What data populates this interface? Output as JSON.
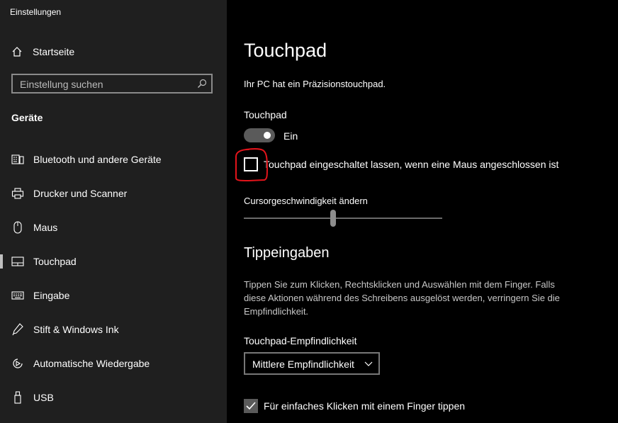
{
  "app": {
    "title": "Einstellungen"
  },
  "sidebar": {
    "home_label": "Startseite",
    "search_placeholder": "Einstellung suchen",
    "section_title": "Geräte",
    "items": [
      {
        "label": "Bluetooth und andere Geräte",
        "icon": "bluetooth-devices-icon",
        "selected": false
      },
      {
        "label": "Drucker und Scanner",
        "icon": "printer-icon",
        "selected": false
      },
      {
        "label": "Maus",
        "icon": "mouse-icon",
        "selected": false
      },
      {
        "label": "Touchpad",
        "icon": "touchpad-icon",
        "selected": true
      },
      {
        "label": "Eingabe",
        "icon": "keyboard-icon",
        "selected": false
      },
      {
        "label": "Stift & Windows Ink",
        "icon": "pen-icon",
        "selected": false
      },
      {
        "label": "Automatische Wiedergabe",
        "icon": "autoplay-icon",
        "selected": false
      },
      {
        "label": "USB",
        "icon": "usb-icon",
        "selected": false
      }
    ]
  },
  "main": {
    "title": "Touchpad",
    "precision_note": "Ihr PC hat ein Präzisionstouchpad.",
    "touchpad_label": "Touchpad",
    "toggle": {
      "state_label": "Ein",
      "on": true
    },
    "mouse_checkbox": {
      "label": "Touchpad eingeschaltet lassen, wenn eine Maus angeschlossen ist",
      "checked": false
    },
    "cursor_speed": {
      "label": "Cursorgeschwindigkeit ändern",
      "value_fraction": 0.45
    },
    "tapping": {
      "heading": "Tippeingaben",
      "description": "Tippen Sie zum Klicken, Rechtsklicken und Auswählen mit dem Finger. Falls diese Aktionen während des Schreibens ausgelöst werden, verringern Sie die Empfindlichkeit.",
      "sensitivity_label": "Touchpad-Empfindlichkeit",
      "sensitivity_value": "Mittlere Empfindlichkeit",
      "single_tap": {
        "label": "Für einfaches Klicken mit einem Finger tippen",
        "checked": true
      }
    }
  },
  "colors": {
    "annotation": "#e3141b",
    "sidebar_bg": "#1f1f1f",
    "main_bg": "#000000"
  }
}
